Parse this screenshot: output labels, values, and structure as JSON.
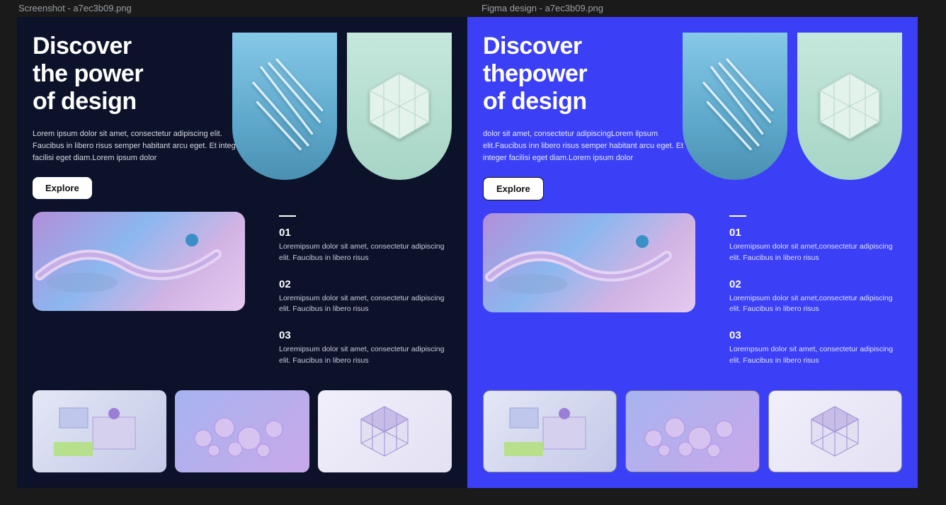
{
  "tabs": {
    "left": "Screenshot - a7ec3b09.png",
    "right": "Figma design - a7ec3b09.png"
  },
  "left": {
    "headline_l1": "Discover",
    "headline_l2": "the power",
    "headline_l3": "of design",
    "lead": "Lorem ipsum dolor sit amet, consectetur adipiscing elit. Faucibus in libero risus semper habitant arcu eget. Et integer facilisi eget diam.Lorem ipsum dolor",
    "explore": "Explore",
    "items": [
      {
        "num": "01",
        "txt": "Loremipsum dolor sit amet, consectetur adipiscing elit. Faucibus in libero risus"
      },
      {
        "num": "02",
        "txt": "Loremipsum dolor sit amet, consectetur adipiscing elit. Faucibus in libero risus"
      },
      {
        "num": "03",
        "txt": "Loremipsum dolor sit amet, consectetur adipiscing elit. Faucibus in libero risus"
      }
    ]
  },
  "right": {
    "headline_l1": "Discover",
    "headline_l2": "thepower",
    "headline_l3": "of design",
    "lead": " dolor sit amet, consectetur adipiscingLorem ilpsum elit.Faucibus inn libero risus semper habitant arcu eget. Et integer facilisi eget diam.Lorem ipsum dolor",
    "explore": "Explore",
    "items": [
      {
        "num": "01",
        "txt": "Loremipsum dolor sit amet,consectetur adipiscing elit. Faucibus in libero risus"
      },
      {
        "num": "02",
        "txt": "Loremipsum dolor sit amet,consectetur adipiscing elit. Faucibus in libero risus"
      },
      {
        "num": "03",
        "txt": "Lorempsum dolor sit amet, consectetur adipiscing elit. Faucibus in libero risus"
      }
    ]
  },
  "images": {
    "arch_blue": "crystal-swirl-icon",
    "arch_mint": "voxel-cube-icon",
    "feature": "glass-snake-icon",
    "thumb1": "tech-machine-icon",
    "thumb2": "bubbles-icon",
    "thumb3": "rubik-icon"
  }
}
